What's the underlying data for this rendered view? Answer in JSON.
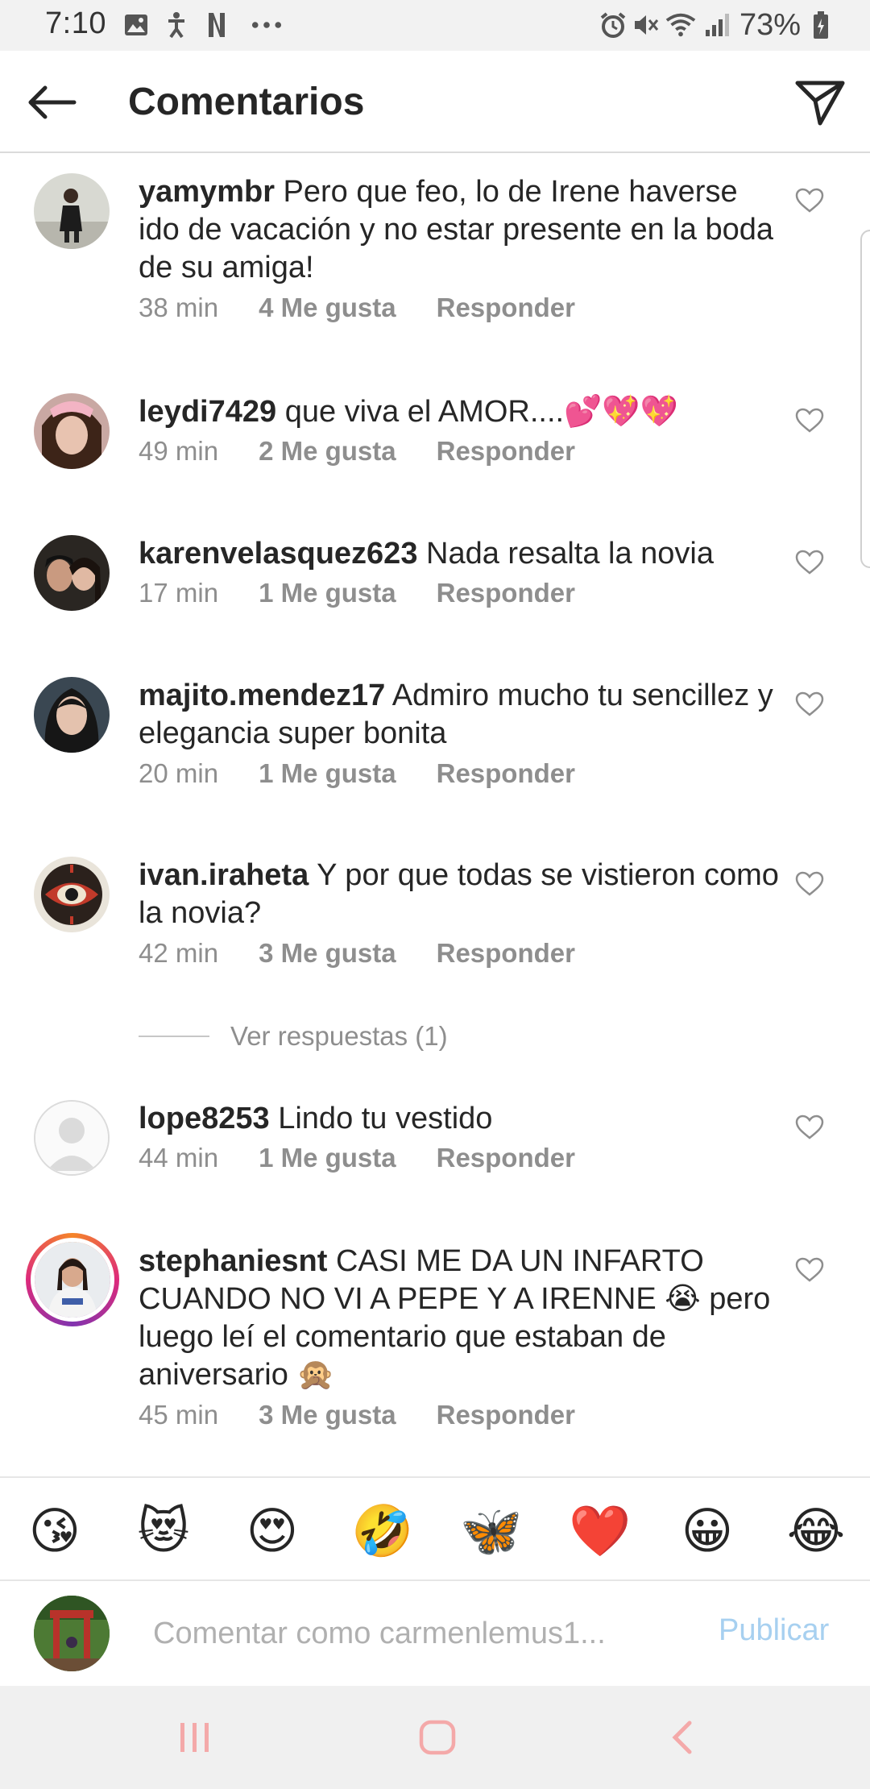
{
  "status_bar": {
    "time": "7:10",
    "battery": "73%"
  },
  "header": {
    "title": "Comentarios"
  },
  "comments": [
    {
      "username": "yamymbr",
      "text": "Pero que feo, lo de Irene haverse ido de vacación y no estar presente en la boda de su amiga!",
      "time": "38 min",
      "likes": "4 Me gusta",
      "reply": "Responder"
    },
    {
      "username": "leydi7429",
      "text": "que viva el AMOR....💕💖💖",
      "time": "49 min",
      "likes": "2 Me gusta",
      "reply": "Responder"
    },
    {
      "username": "karenvelasquez623",
      "text": "Nada resalta la novia",
      "time": "17 min",
      "likes": "1 Me gusta",
      "reply": "Responder"
    },
    {
      "username": "majito.mendez17",
      "text": "Admiro mucho tu sencillez y elegancia super bonita",
      "time": "20 min",
      "likes": "1 Me gusta",
      "reply": "Responder"
    },
    {
      "username": "ivan.iraheta",
      "text": "Y por que todas se vistieron como la novia?",
      "time": "42 min",
      "likes": "3 Me gusta",
      "reply": "Responder"
    },
    {
      "username": "lope8253",
      "text": "Lindo tu vestido",
      "time": "44 min",
      "likes": "1 Me gusta",
      "reply": "Responder"
    },
    {
      "username": "stephaniesnt",
      "text": "CASI ME DA UN INFARTO CUANDO NO VI A PEPE Y A IRENNE 😭 pero luego leí el comentario que estaban de aniversario 🙊",
      "time": "45 min",
      "likes": "3 Me gusta",
      "reply": "Responder"
    }
  ],
  "view_replies": "Ver respuestas (1)",
  "emoji_bar": [
    "😘",
    "😻",
    "😍",
    "🤣",
    "🦋",
    "❤️",
    "😀",
    "😂"
  ],
  "comment_input": {
    "placeholder": "Comentar como carmenlemus1...",
    "publish_label": "Publicar"
  },
  "colors": {
    "publish_disabled": "#a7d0f0",
    "meta_gray": "#8e8e8e",
    "nav_icon": "#f4a9a9",
    "story_ring": "#dd2a7b"
  },
  "icons": {
    "back": "arrow-left-icon",
    "send": "paper-plane-icon",
    "like": "heart-outline-icon"
  }
}
